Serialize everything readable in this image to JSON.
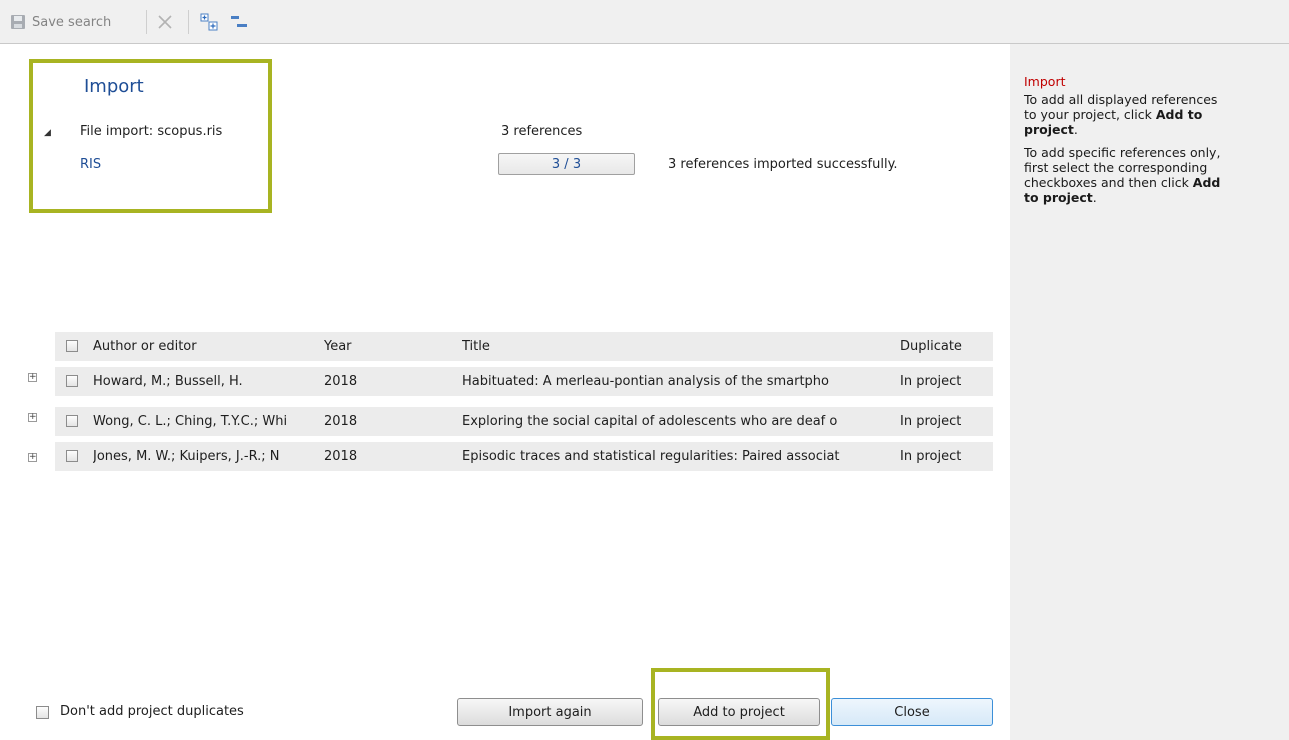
{
  "toolbar": {
    "save_search_label": "Save search",
    "icons": [
      "save-icon",
      "delete-icon",
      "expand-all-icon",
      "collapse-all-icon"
    ]
  },
  "import_panel": {
    "title": "Import",
    "file_line": "File import: scopus.ris",
    "format": "RIS",
    "ref_count": "3 references",
    "progress_text": "3 / 3",
    "progress_fraction": 1.0,
    "status": "3 references imported successfully."
  },
  "table": {
    "headers": {
      "author": "Author or editor",
      "year": "Year",
      "title": "Title",
      "duplicate": "Duplicate"
    },
    "rows": [
      {
        "author": "Howard, M.; Bussell, H.",
        "year": "2018",
        "title": "Habituated: A merleau-pontian analysis of the smartpho",
        "duplicate": "In project"
      },
      {
        "author": "Wong, C. L.; Ching, T.Y.C.; Whi",
        "year": "2018",
        "title": "Exploring the social capital of adolescents who are deaf o",
        "duplicate": "In project"
      },
      {
        "author": "Jones, M. W.; Kuipers, J.-R.; N",
        "year": "2018",
        "title": "Episodic traces and statistical regularities: Paired associat",
        "duplicate": "In project"
      }
    ]
  },
  "bottom": {
    "dont_add_duplicates_label": "Don't add project duplicates",
    "import_again_label": "Import again",
    "add_to_project_label": "Add to project",
    "close_label": "Close"
  },
  "help": {
    "title": "Import",
    "p1_text": "To add all displayed references to your project, click ",
    "p1_bold": "Add to project",
    "p1_end": ".",
    "p2_text": "To add specific references only, first select the corresponding checkboxes and then click ",
    "p2_bold": "Add to project",
    "p2_end": "."
  },
  "colors": {
    "highlight": "#a8b422",
    "link_blue": "#1f4e96",
    "help_title": "#c00000",
    "panel_bg": "#f0f0f0"
  }
}
